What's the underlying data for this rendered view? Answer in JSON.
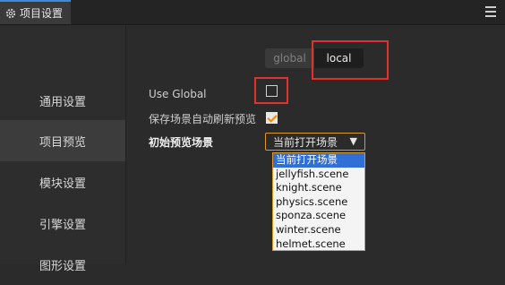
{
  "titlebar": {
    "tab_label": "项目设置",
    "tab_icon": "gear-icon",
    "menu_icon": "hamburger-menu-icon",
    "accent": "#3d8bd4"
  },
  "sidebar": {
    "items": [
      {
        "label": "通用设置"
      },
      {
        "label": "项目预览",
        "active": true
      },
      {
        "label": "模块设置"
      },
      {
        "label": "引擎设置"
      },
      {
        "label": "图形设置"
      }
    ]
  },
  "scope_toggle": {
    "global_label": "global",
    "local_label": "local",
    "selected": "local"
  },
  "settings": {
    "use_global_label": "Use Global",
    "use_global_checked": false,
    "auto_refresh_label": "保存场景自动刷新预览",
    "auto_refresh_checked": true,
    "initial_scene_label": "初始预览场景",
    "initial_scene_value": "当前打开场景",
    "initial_scene_options": [
      "当前打开场景",
      "jellyfish.scene",
      "knight.scene",
      "physics.scene",
      "sponza.scene",
      "winter.scene",
      "helmet.scene"
    ]
  },
  "colors": {
    "highlight_box": "#e03030",
    "checkbox_check": "#f08a00",
    "select_border": "#d89a2a",
    "option_selected": "#2f6fd6"
  }
}
